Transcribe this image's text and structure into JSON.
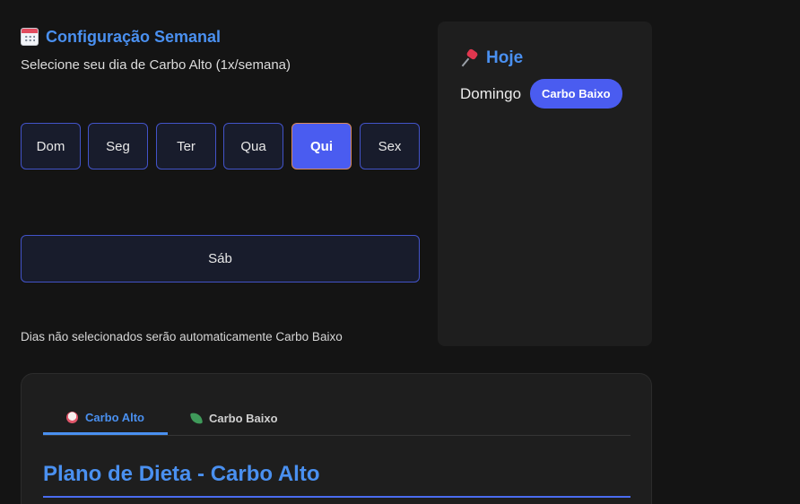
{
  "config": {
    "title": "Configuração Semanal",
    "title_icon": "calendar-icon",
    "subtitle": "Selecione seu dia de Carbo Alto (1x/semana)",
    "days": [
      "Dom",
      "Seg",
      "Ter",
      "Qua",
      "Qui",
      "Sex",
      "Sáb"
    ],
    "selected_day": "Qui",
    "note": "Dias não selecionados serão automaticamente Carbo Baixo"
  },
  "today": {
    "title": "Hoje",
    "title_icon": "pushpin-icon",
    "day": "Domingo",
    "badge": "Carbo Baixo"
  },
  "plan": {
    "tabs": [
      {
        "label": "Carbo Alto",
        "icon": "rice-icon",
        "active": true
      },
      {
        "label": "Carbo Baixo",
        "icon": "leaf-icon",
        "active": false
      }
    ],
    "title": "Plano de Dieta - Carbo Alto"
  },
  "colors": {
    "accent": "#4a90f0",
    "button_active": "#4a5cf0",
    "button_border": "#4253c8",
    "background": "#141414",
    "panel": "#1e1e1e"
  }
}
